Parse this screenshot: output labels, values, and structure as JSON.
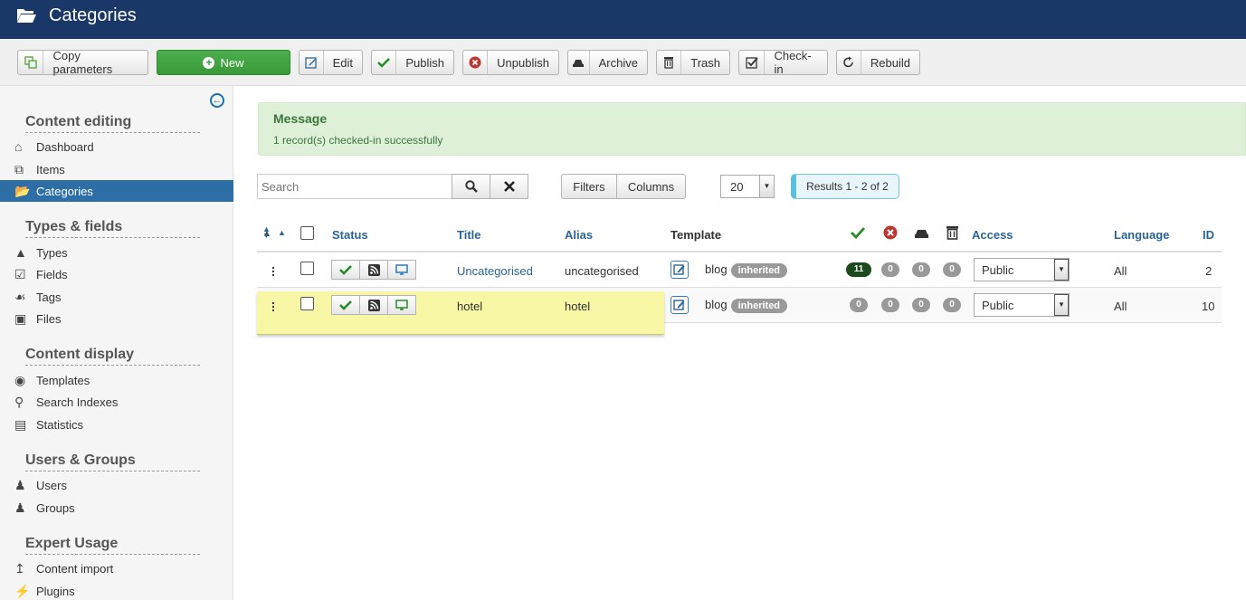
{
  "header": {
    "title": "Categories"
  },
  "toolbar": {
    "copy": "Copy parameters",
    "new": "New",
    "edit": "Edit",
    "publish": "Publish",
    "unpublish": "Unpublish",
    "archive": "Archive",
    "trash": "Trash",
    "checkin": "Check-in",
    "rebuild": "Rebuild"
  },
  "sidebar": {
    "sections": {
      "content_editing": "Content editing",
      "types_fields": "Types & fields",
      "content_display": "Content display",
      "users_groups": "Users & Groups",
      "expert_usage": "Expert Usage"
    },
    "items": {
      "dashboard": "Dashboard",
      "items": "Items",
      "categories": "Categories",
      "types": "Types",
      "fields": "Fields",
      "tags": "Tags",
      "files": "Files",
      "templates": "Templates",
      "search_indexes": "Search Indexes",
      "statistics": "Statistics",
      "users": "Users",
      "groups": "Groups",
      "content_import": "Content import",
      "plugins": "Plugins"
    }
  },
  "message": {
    "heading": "Message",
    "text": "1 record(s) checked-in successfully"
  },
  "filter": {
    "search_placeholder": "Search",
    "filters": "Filters",
    "columns": "Columns",
    "limit": "20",
    "results": "Results 1 - 2 of 2"
  },
  "table": {
    "headers": {
      "status": "Status",
      "title": "Title",
      "alias": "Alias",
      "template": "Template",
      "access": "Access",
      "language": "Language",
      "id": "ID"
    },
    "rows": [
      {
        "title": "Uncategorised",
        "alias": "uncategorised",
        "template": "blog",
        "template_tag": "inherited",
        "published": "11",
        "unpublished": "0",
        "archived": "0",
        "trashed": "0",
        "access": "Public",
        "language": "All",
        "id": "2"
      },
      {
        "title": "hotel",
        "alias": "hotel",
        "template": "blog",
        "template_tag": "inherited",
        "published": "0",
        "unpublished": "0",
        "archived": "0",
        "trashed": "0",
        "access": "Public",
        "language": "All",
        "id": "10"
      }
    ]
  },
  "colors": {
    "header": "#1a3867",
    "new_button": "#4cae4c",
    "active_sidebar": "#2e6ea7",
    "message_bg": "#dff0d8",
    "highlight": "#f7f7a6"
  }
}
